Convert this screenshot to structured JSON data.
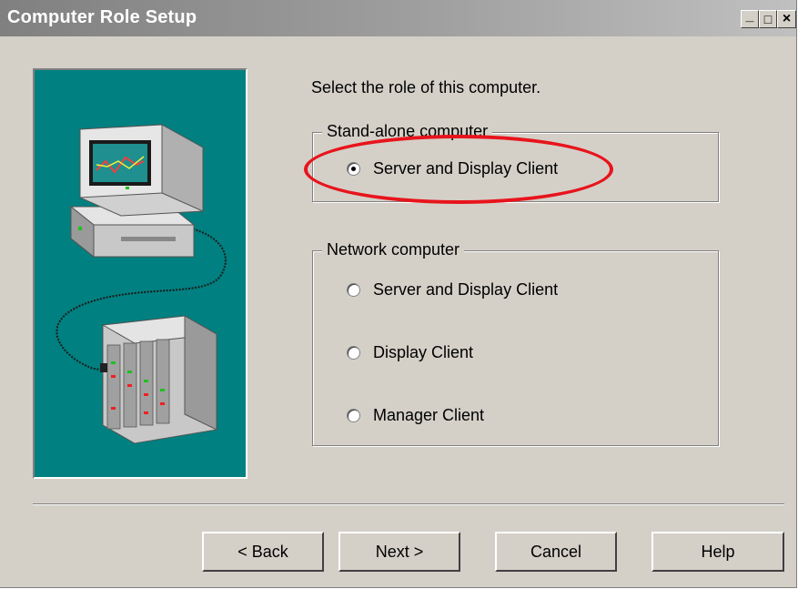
{
  "window": {
    "title": "Computer Role Setup",
    "controls": {
      "minimize": "_",
      "maximize": "□",
      "close": "×"
    }
  },
  "prompt": "Select the role of this computer.",
  "groups": {
    "standalone": {
      "label": "Stand-alone computer",
      "options": [
        {
          "label": "Server and Display Client",
          "checked": true
        }
      ]
    },
    "network": {
      "label": "Network computer",
      "options": [
        {
          "label": "Server and Display Client",
          "checked": false
        },
        {
          "label": "Display Client",
          "checked": false
        },
        {
          "label": "Manager Client",
          "checked": false
        }
      ]
    }
  },
  "buttons": {
    "back": "< Back",
    "next": "Next >",
    "cancel": "Cancel",
    "help": "Help"
  },
  "colors": {
    "accent_highlight": "#e8141c",
    "illustration_bg": "#008080",
    "dialog_bg": "#d4d0c8"
  }
}
